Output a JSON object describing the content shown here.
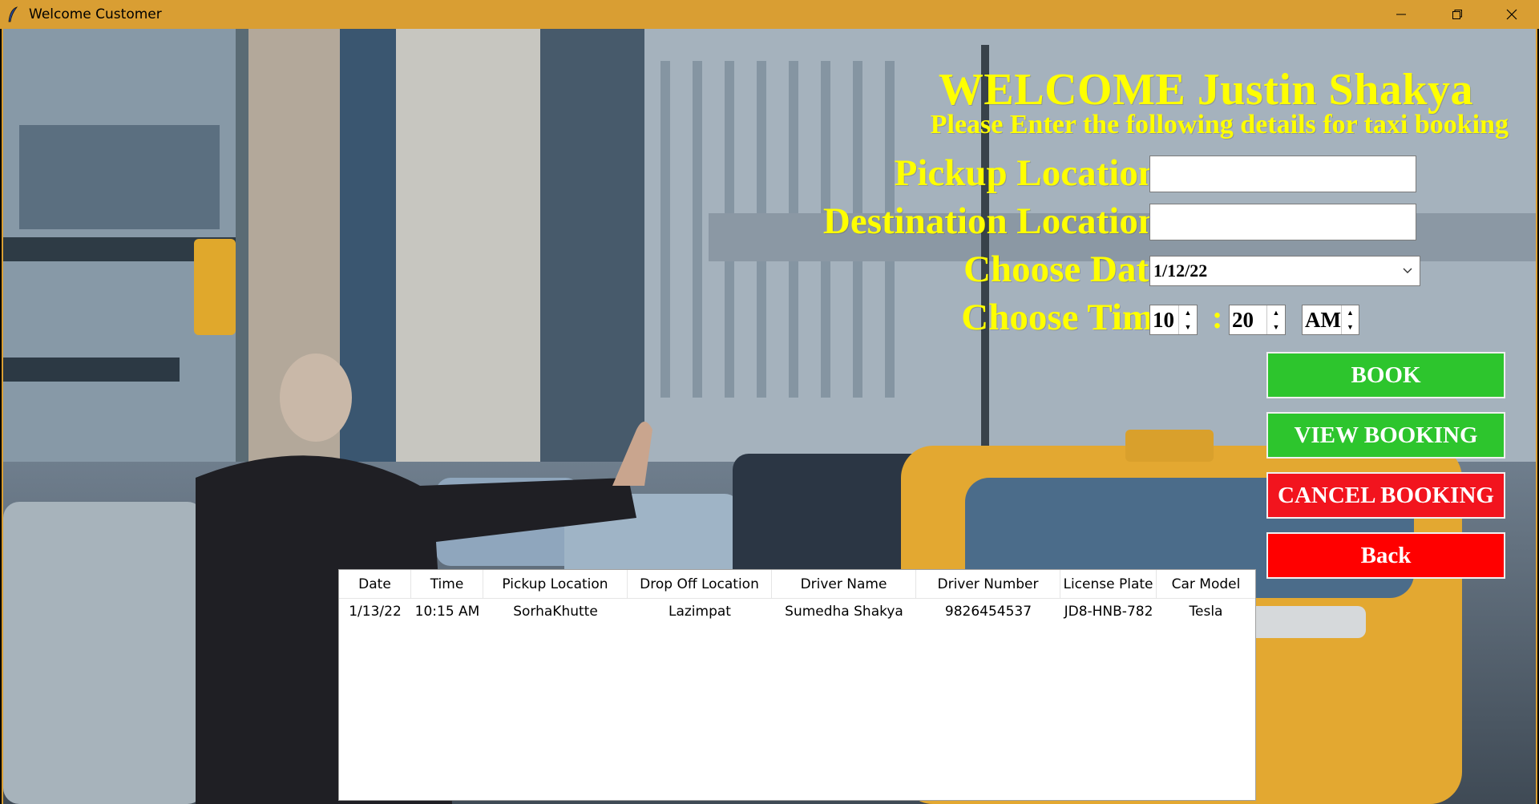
{
  "window": {
    "title": "Welcome Customer"
  },
  "header": {
    "welcome": "WELCOME Justin Shakya",
    "subtitle": "Please Enter the following details for taxi booking"
  },
  "form": {
    "pickup_label": "Pickup Location",
    "pickup_value": "",
    "destination_label": "Destination Location",
    "destination_value": "",
    "date_label": "Choose Date",
    "date_value": "1/12/22",
    "time_label": "Choose Time",
    "hour": "10",
    "separator": ":",
    "minute": "20",
    "ampm": "AM"
  },
  "buttons": {
    "book": "BOOK",
    "view": "VIEW BOOKING",
    "cancel": "CANCEL BOOKING",
    "back": "Back"
  },
  "table": {
    "columns": [
      "Date",
      "Time",
      "Pickup Location",
      "Drop Off  Location",
      "Driver Name",
      "Driver Number",
      "License Plate",
      "Car Model"
    ],
    "rows": [
      [
        "1/13/22",
        "10:15 AM",
        "SorhaKhutte",
        "Lazimpat",
        "Sumedha Shakya",
        "9826454537",
        "JD8-HNB-782",
        "Tesla"
      ]
    ]
  },
  "colors": {
    "titlebar": "#d99e33",
    "heading_text": "#ffff00",
    "green_button": "#2dc52d",
    "red_button": "#ff0000"
  },
  "icons": {
    "app": "feather-icon",
    "minimize": "minimize-icon",
    "maximize": "restore-icon",
    "close": "close-icon",
    "dropdown": "chevron-down-icon"
  }
}
